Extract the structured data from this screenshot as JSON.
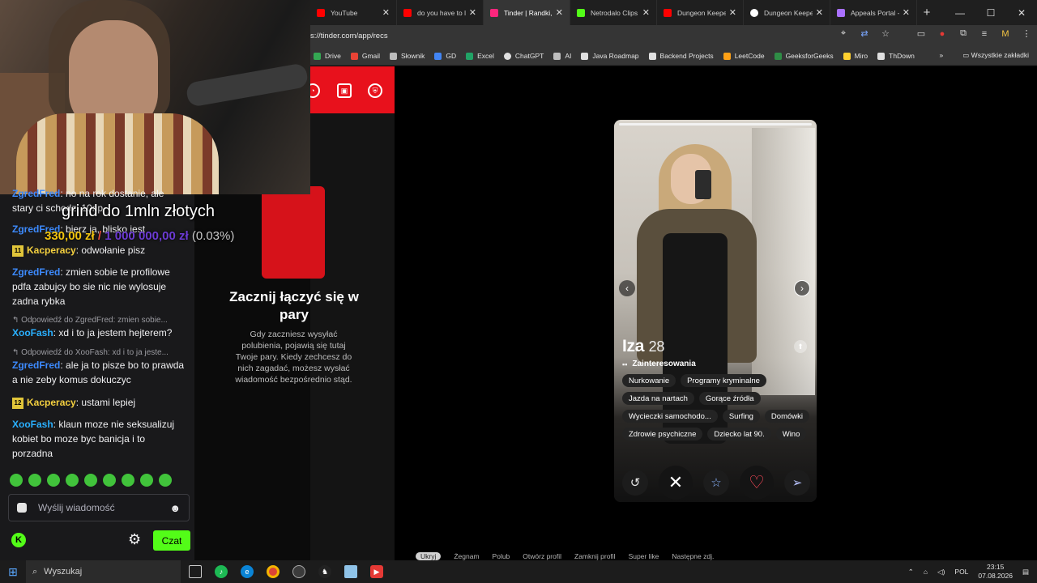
{
  "browser": {
    "tabs": [
      {
        "title": "YouTube",
        "color": "#ff0000",
        "active": false
      },
      {
        "title": "do you have to le",
        "color": "#ff0000",
        "active": false
      },
      {
        "title": "Tinder | Randki, p",
        "color": "#fd267d",
        "active": true
      },
      {
        "title": "Netrodalo Clips",
        "color": "#53fc18",
        "active": false
      },
      {
        "title": "Dungeon Keeper",
        "color": "#ff0000",
        "active": false
      },
      {
        "title": "Dungeon Keepe",
        "color": "#ffffff",
        "active": false
      },
      {
        "title": "Appeals Portal -",
        "color": "#a970ff",
        "active": false
      }
    ],
    "new_tab": "+",
    "url": "s://tinder.com/app/recs",
    "bookmarks": [
      {
        "label": "Drive",
        "color": "#34a853"
      },
      {
        "label": "Gmail",
        "color": "#ea4335"
      },
      {
        "label": "Słownik",
        "color": "#bdbdbd"
      },
      {
        "label": "GD",
        "color": "#4285f4"
      },
      {
        "label": "Excel",
        "color": "#21a366"
      },
      {
        "label": "ChatGPT",
        "color": "#e0e0e0"
      },
      {
        "label": "AI",
        "color": "#bdbdbd"
      },
      {
        "label": "Java Roadmap",
        "color": "#e0e0e0"
      },
      {
        "label": "Backend Projects",
        "color": "#e0e0e0"
      },
      {
        "label": "LeetCode",
        "color": "#ffa116"
      },
      {
        "label": "GeeksforGeeks",
        "color": "#2f8d46"
      },
      {
        "label": "Miro",
        "color": "#ffd02f"
      },
      {
        "label": "ThDown",
        "color": "#e0e0e0"
      }
    ],
    "bookmarks_all": "Wszystkie zakładki",
    "bookmarks_more": "»"
  },
  "tinder": {
    "empty_title": "Zacznij łączyć się w pary",
    "empty_desc": "Gdy zaczniesz wysyłać polubienia, pojawią się tutaj Twoje pary. Kiedy zechcesz do nich zagadać, możesz wysłać wiadomość bezpośrednio stąd.",
    "profile": {
      "name": "Iza",
      "age": "28",
      "interests_label": "Zainteresowania",
      "interests": [
        "Nurkowanie",
        "Programy kryminalne",
        "Jazda na nartach",
        "Gorące źródła",
        "Wycieczki samochodo...",
        "Surfing",
        "Domówki",
        "Zdrowie psychiczne",
        "Dziecko lat 90.",
        "Wino"
      ]
    },
    "hints": [
      "Ukryj",
      "Żegnam",
      "Polub",
      "Otwórz profil",
      "Zamknij profil",
      "Super like",
      "Następne zdj."
    ]
  },
  "overlay": {
    "goal_title": "grind do 1mln złotych",
    "goal_current": "330,00 zł",
    "goal_sep": "/",
    "goal_target": "1 000 000,00 zł",
    "goal_pct": "(0.03%)"
  },
  "chat": {
    "messages": [
      {
        "user": "ZgredFred",
        "text": "no na rok dostanie, ale stary ci schodzi 10np"
      },
      {
        "user": "ZgredFred",
        "text": "bierz ja, blisko jest"
      },
      {
        "badge": "11",
        "user": "Kacperacy",
        "text": "odwołanie pisz"
      },
      {
        "user": "ZgredFred",
        "text": "zmien sobie te profilowe pdfa zabujcy bo sie nic nie wylosuje zadna rybka"
      },
      {
        "reply": "Odpowiedź do ZgredFred: zmien sobie...",
        "user": "XooFash",
        "text": "xd i to ja jestem hejterem?"
      },
      {
        "reply": "Odpowiedź do XooFash: xd i to ja jeste...",
        "user": "ZgredFred",
        "text": "ale ja to pisze bo to prawda a nie zeby komus dokuczyc"
      },
      {
        "badge": "12",
        "user": "Kacperacy",
        "text": "ustami lepiej"
      },
      {
        "user": "XooFash",
        "text": "klaun moze nie seksualizuj kobiet bo moze byc banicja i to porzadna"
      }
    ],
    "input_placeholder": "Wyślij wiadomość",
    "send_label": "Czat"
  },
  "taskbar": {
    "search_placeholder": "Wyszukaj",
    "lang": "POL",
    "time": "23:15",
    "date": "07.08.2026"
  }
}
